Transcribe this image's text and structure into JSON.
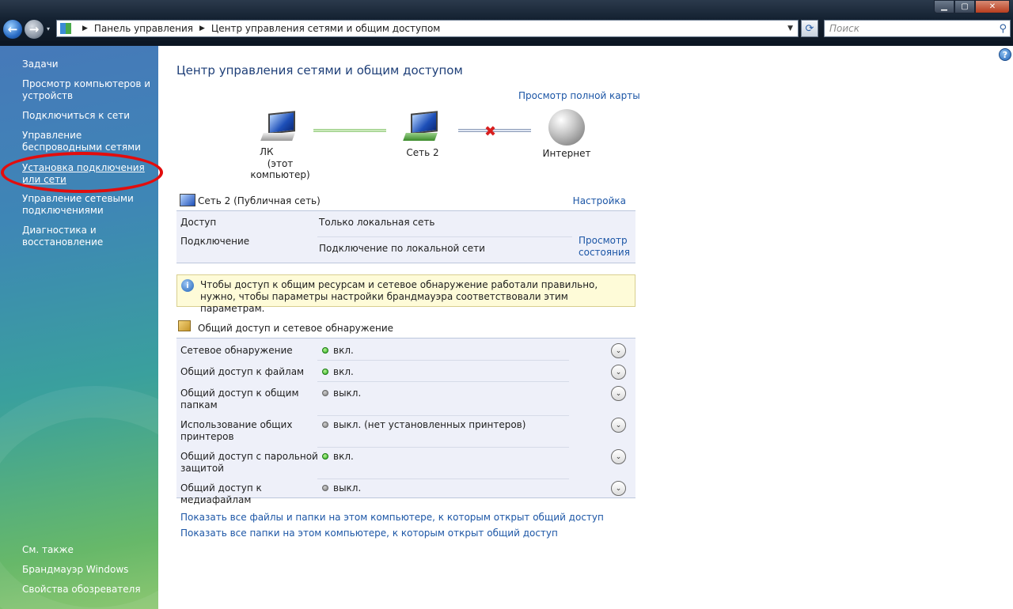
{
  "window": {
    "controls": {
      "minimize": "▁",
      "maximize": "▢",
      "close": "✕"
    }
  },
  "nav": {
    "back": "←",
    "forward": "→",
    "dropdown": "▾"
  },
  "address": {
    "separator": "▶",
    "crumbs": [
      "Панель управления",
      "Центр управления сетями и общим доступом"
    ],
    "dropdown": "▼"
  },
  "refresh_glyph": "⟳",
  "search": {
    "placeholder": "Поиск",
    "icon": "⚲"
  },
  "left_pane": {
    "tasks_title": "Задачи",
    "links": [
      "Просмотр компьютеров и устройств",
      "Подключиться к сети",
      "Управление беспроводными сетями",
      "Установка подключения или сети",
      "Управление сетевыми подключениями",
      "Диагностика и восстановление"
    ],
    "see_also_title": "См. также",
    "see_also": [
      "Брандмауэр Windows",
      "Свойства обозревателя"
    ]
  },
  "main": {
    "help": "?",
    "title": "Центр управления сетями и общим доступом",
    "full_map_link": "Просмотр полной карты",
    "map": {
      "computer_label": "ЛК",
      "computer_sub": "(этот компьютер)",
      "network_label": "Сеть  2",
      "internet_label": "Интернет",
      "disconnected": "✖"
    },
    "network": {
      "name": "Сеть  2 (Публичная сеть)",
      "configure_link": "Настройка",
      "access_label": "Доступ",
      "access_value": "Только локальная сеть",
      "connection_label": "Подключение",
      "connection_value": "Подключение по локальной сети",
      "status_link": "Просмотр состояния"
    },
    "warning": {
      "icon": "i",
      "text": "Чтобы доступ к общим ресурсам и сетевое обнаружение работали правильно, нужно, чтобы параметры настройки брандмауэра соответствовали этим параметрам."
    },
    "sharing": {
      "title": "Общий доступ и сетевое обнаружение",
      "chevron": "⌄",
      "rows": [
        {
          "name": "Сетевое обнаружение",
          "state": "вкл.",
          "on": true
        },
        {
          "name": "Общий доступ к файлам",
          "state": "вкл.",
          "on": true
        },
        {
          "name": "Общий доступ к общим папкам",
          "state": "выкл.",
          "on": false
        },
        {
          "name": "Использование общих принтеров",
          "state": "выкл. (нет установленных принтеров)",
          "on": false
        },
        {
          "name": "Общий доступ с парольной защитой",
          "state": "вкл.",
          "on": true
        },
        {
          "name": "Общий доступ к медиафайлам",
          "state": "выкл.",
          "on": false
        }
      ]
    },
    "bottom_links": [
      "Показать все файлы и папки на этом компьютере, к которым открыт общий доступ",
      "Показать все папки на этом компьютере, к которым открыт общий доступ"
    ]
  },
  "colors": {
    "link": "#1c56a6",
    "title": "#1e3f78",
    "status_on": "#2aa91a",
    "status_off": "#7a7a7a",
    "highlight": "#e20d0d"
  }
}
